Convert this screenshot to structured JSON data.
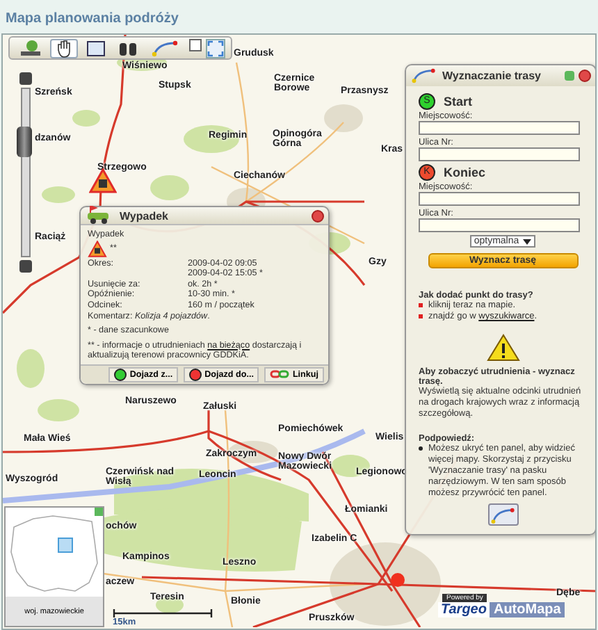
{
  "header": {
    "title": "Mapa planowania podróży"
  },
  "toolbar": {
    "tools": [
      {
        "kind": "layers",
        "selected": false
      },
      {
        "kind": "pan",
        "selected": true
      },
      {
        "kind": "zoom-box",
        "selected": false
      },
      {
        "kind": "search",
        "selected": false
      },
      {
        "kind": "route",
        "selected": false
      }
    ],
    "fullscreen": {
      "checked": false
    }
  },
  "map": {
    "zoom": {
      "level": 0.68
    },
    "places": [
      {
        "name": "Wiśniewo"
      },
      {
        "name": "Grudusk"
      },
      {
        "name": "Szreńsk"
      },
      {
        "name": "Stupsk"
      },
      {
        "name": "Czernice Borowe"
      },
      {
        "name": "Przasnysz"
      },
      {
        "name": "dzanów"
      },
      {
        "name": "Regimin"
      },
      {
        "name": "Opinogóra Górna"
      },
      {
        "name": "Kras"
      },
      {
        "name": "Strzegowo"
      },
      {
        "name": "Ciechanów"
      },
      {
        "name": "Raciąż"
      },
      {
        "name": "Gzy"
      },
      {
        "name": "Naruszewo"
      },
      {
        "name": "Załuski"
      },
      {
        "name": "Pomiechówek"
      },
      {
        "name": "Mała Wieś"
      },
      {
        "name": "Wielis"
      },
      {
        "name": "Zakroczym"
      },
      {
        "name": "Nowy Dwór Mazowiecki"
      },
      {
        "name": "Wyszogród"
      },
      {
        "name": "Czerwińsk nad Wisłą"
      },
      {
        "name": "Leoncin"
      },
      {
        "name": "Legionowo"
      },
      {
        "name": "Łomianki"
      },
      {
        "name": "ochów"
      },
      {
        "name": "Izabelin C"
      },
      {
        "name": "Kampinos"
      },
      {
        "name": "Leszno"
      },
      {
        "name": "aczew"
      },
      {
        "name": "Teresin"
      },
      {
        "name": "Błonie"
      },
      {
        "name": "Pruszków"
      },
      {
        "name": "Dębe"
      }
    ],
    "scale": "15km",
    "logo": {
      "powered": "Powered by",
      "brand": "Targeo",
      "partner": "AutoMapa"
    }
  },
  "overview": {
    "region": "woj. mazowieckie"
  },
  "incident": {
    "title": "Wypadek",
    "type": "Wypadek",
    "severity": "**",
    "rows": [
      {
        "label": "Okres:",
        "value": "2009-04-02 09:05"
      },
      {
        "value": "2009-04-02 15:05 *"
      },
      {
        "label": "Usunięcie za:",
        "value": "ok. 2h *"
      },
      {
        "label": "Opóźnienie:",
        "value": "10-30 min. *"
      },
      {
        "label": "Odcinek:",
        "value": "160 m / początek"
      }
    ],
    "comment_label": "Komentarz:",
    "comment": "Kolizja 4 pojazdów",
    "comment_end": ".",
    "note_1": "* - dane szacunkowe",
    "note_2_before": "** - informacje o utrudnieniach",
    "note_2_link": "na bieżąco",
    "note_2_after": "dostarczają i aktualizują terenowi pracownicy GDDKiA.",
    "actions": [
      {
        "kind": "from",
        "label": "Dojazd z..."
      },
      {
        "kind": "to",
        "label": "Dojazd do..."
      },
      {
        "kind": "link",
        "label": "Linkuj"
      }
    ]
  },
  "route_panel": {
    "title": "Wyznaczanie trasy",
    "points": [
      {
        "kind": "start",
        "badge": "S",
        "label": "Start",
        "fields": [
          {
            "label": "Miejscowość:"
          },
          {
            "label": "Ulica Nr:"
          }
        ]
      },
      {
        "kind": "end",
        "badge": "K",
        "label": "Koniec",
        "fields": [
          {
            "label": "Miejscowość:"
          },
          {
            "label": "Ulica Nr:"
          }
        ]
      }
    ],
    "mode": "optymalna",
    "submit": "Wyznacz trasę",
    "howto_title": "Jak dodać punkt do trasy?",
    "howto_1": "kliknij teraz na mapie.",
    "howto_2_before": "znajdź go w",
    "howto_2_link": "wyszukiwarce",
    "howto_2_after": ".",
    "warning_title": "Aby zobaczyć utrudnienia - wyznacz trasę.",
    "warning_text": "Wyświetlą się aktualne odcinki utrudnień na drogach krajowych wraz z informacją szczegółową.",
    "hint_title": "Podpowiedź:",
    "hint_text": "Możesz ukryć ten panel, aby widzieć więcej mapy. Skorzystaj z przycisku 'Wyznaczanie trasy' na pasku narzędziowym. W ten sam sposób możesz przywrócić ten panel."
  }
}
